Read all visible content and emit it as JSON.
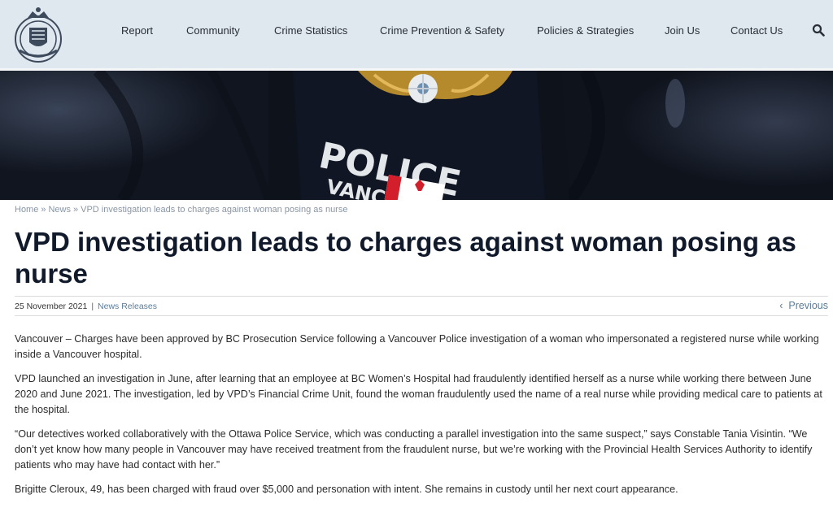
{
  "header": {
    "nav": [
      {
        "label": "Report"
      },
      {
        "label": "Community"
      },
      {
        "label": "Crime Statistics"
      },
      {
        "label": "Crime Prevention & Safety"
      },
      {
        "label": "Policies & Strategies"
      },
      {
        "label": "Join Us"
      },
      {
        "label": "Contact Us"
      }
    ],
    "search_icon": "search-icon"
  },
  "hero": {
    "patch_line1": "POLICE",
    "patch_line2": "VANCOUVER"
  },
  "breadcrumb": {
    "home": "Home",
    "sep": "»",
    "news": "News",
    "current": "VPD investigation leads to charges against woman posing as nurse"
  },
  "article": {
    "title": "VPD investigation leads to charges against woman posing as nurse",
    "date": "25 November 2021",
    "divider": "|",
    "category": "News Releases",
    "previous_label": "Previous",
    "paragraphs": [
      "Vancouver – Charges have been approved by BC Prosecution Service following a Vancouver Police investigation of a woman who impersonated a registered nurse while working inside a Vancouver hospital.",
      "VPD launched an investigation in June, after learning that an employee at BC Women’s Hospital had fraudulently identified herself as a nurse while working there between June 2020 and June 2021. The investigation, led by VPD’s Financial Crime Unit, found the woman fraudulently used the name of a real nurse while providing medical care to patients at the hospital.",
      "“Our detectives worked collaboratively with the Ottawa Police Service, which was conducting a parallel investigation into the same suspect,” says Constable Tania Visintin.  “We don’t yet know how many people in Vancouver may have received treatment from the fraudulent nurse, but we’re working with the Provincial Health Services Authority to identify patients who may have had contact with her.”",
      "Brigitte Cleroux, 49, has been charged with fraud over $5,000 and personation with intent. She remains in custody until her next court appearance."
    ]
  },
  "colors": {
    "header_bg": "#dfe7ef",
    "link": "#5b7c99",
    "title": "#111a2b"
  }
}
